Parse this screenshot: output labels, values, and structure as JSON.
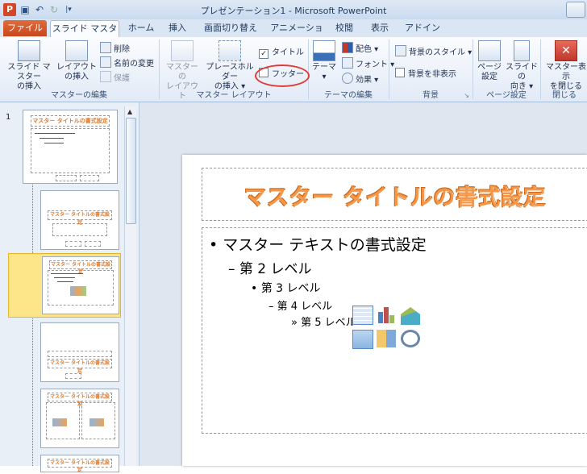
{
  "app": {
    "title": "プレゼンテーション1 - Microsoft PowerPoint",
    "icon_label": "P"
  },
  "tabs": [
    {
      "label": "ファイル"
    },
    {
      "label": "スライド マスター"
    },
    {
      "label": "ホーム"
    },
    {
      "label": "挿入"
    },
    {
      "label": "画面切り替え"
    },
    {
      "label": "アニメーション"
    },
    {
      "label": "校閲"
    },
    {
      "label": "表示"
    },
    {
      "label": "アドイン"
    }
  ],
  "ribbon": {
    "master_edit": {
      "label": "マスターの編集",
      "insert_slide_master_line1": "スライド マスター",
      "insert_slide_master_line2": "の挿入",
      "insert_layout_line1": "レイアウト",
      "insert_layout_line2": "の挿入",
      "delete": "削除",
      "rename": "名前の変更",
      "preserve": "保護"
    },
    "master_layout": {
      "label": "マスター レイアウト",
      "master_layout_line1": "マスターの",
      "master_layout_line2": "レイアウト",
      "insert_placeholder_line1": "プレースホルダー",
      "insert_placeholder_line2": "の挿入",
      "title_check": "タイトル",
      "footer_check": "フッター"
    },
    "edit_theme": {
      "label": "テーマの編集",
      "themes": "テーマ",
      "colors": "配色",
      "fonts": "フォント",
      "effects": "効果"
    },
    "background": {
      "label": "背景",
      "background_styles": "背景のスタイル",
      "hide_background": "背景を非表示"
    },
    "page_setup": {
      "label": "ページ設定",
      "page_setup_line1": "ページ",
      "page_setup_line2": "設定",
      "orientation_line1": "スライドの",
      "orientation_line2": "向き"
    },
    "close": {
      "label": "閉じる",
      "close_master_line1": "マスター表示",
      "close_master_line2": "を閉じる"
    }
  },
  "thumbnails": {
    "slide_number": "1",
    "title_text": "マスター タイトルの書式設定"
  },
  "slide": {
    "title": "マスター タイトルの書式設定",
    "level1": "• マスター テキストの書式設定",
    "level2": "– 第 2 レベル",
    "level3": "• 第 3 レベル",
    "level4": "– 第 4 レベル",
    "level5": "» 第 5 レベル"
  },
  "colors": {
    "accent_orange": "#f79646",
    "file_tab": "#d24726",
    "annotation_red": "#e23b3b"
  }
}
